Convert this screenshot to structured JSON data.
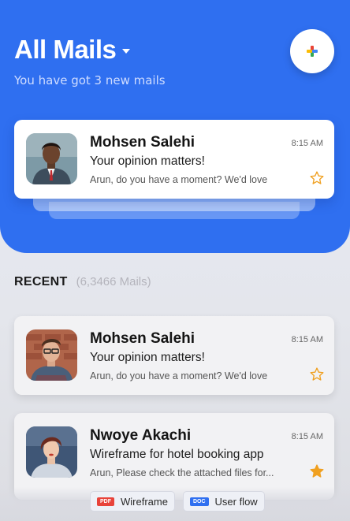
{
  "header": {
    "title": "All Mails",
    "subtitle": "You have got 3 new mails"
  },
  "featured_mail": {
    "sender": "Mohsen Salehi",
    "subject": "Your opinion matters!",
    "preview": "Arun, do you have a moment? We'd love",
    "time": "8:15 AM",
    "starred": false
  },
  "recent": {
    "label": "RECENT",
    "count": "(6,3466 Mails)",
    "mails": [
      {
        "sender": "Mohsen Salehi",
        "subject": "Your opinion matters!",
        "preview": "Arun, do you have a moment? We'd love",
        "time": "8:15 AM",
        "starred": false
      },
      {
        "sender": "Nwoye Akachi",
        "subject": "Wireframe for hotel booking app",
        "preview": "Arun, Please check the attached files for...",
        "time": "8:15 AM",
        "starred": true,
        "attachments": [
          {
            "type": "PDF",
            "name": "Wireframe"
          },
          {
            "type": "DOC",
            "name": "User flow"
          }
        ]
      }
    ]
  },
  "colors": {
    "accent": "#2f6ff0",
    "star_filled": "#f0a020",
    "star_outline": "#f0a020"
  }
}
